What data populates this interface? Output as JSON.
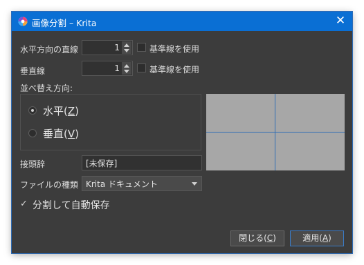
{
  "window": {
    "title": "画像分割 – Krita",
    "close_glyph": "✕",
    "accent": "#0a6fd4"
  },
  "horizontal_lines": {
    "label": "水平方向の直線",
    "value": "1",
    "guide_label": "基準線を使用",
    "guide_checked": false
  },
  "vertical_lines": {
    "label": "垂直線",
    "value": "1",
    "guide_label": "基準線を使用",
    "guide_checked": false
  },
  "sort_direction": {
    "label": "並べ替え方向:",
    "options": [
      {
        "label": "水平(",
        "accel": "Z",
        "suffix": ")",
        "selected": true
      },
      {
        "label": "垂直(",
        "accel": "V",
        "suffix": ")",
        "selected": false
      }
    ]
  },
  "prefix": {
    "label": "接頭辞",
    "value": "[未保存]"
  },
  "file_type": {
    "label": "ファイルの種類",
    "selected": "Krita ドキュメント"
  },
  "autosave": {
    "label": "分割して自動保存",
    "checked": true,
    "glyph": "✓"
  },
  "buttons": {
    "close": {
      "label": "閉じる(",
      "accel": "C",
      "suffix": ")"
    },
    "apply": {
      "label": "適用(",
      "accel": "A",
      "suffix": ")"
    }
  },
  "icons": {
    "app": "krita-logo-icon",
    "spin_arrows": "spin-arrows-icon",
    "combo_caret": "chevron-down-icon"
  }
}
